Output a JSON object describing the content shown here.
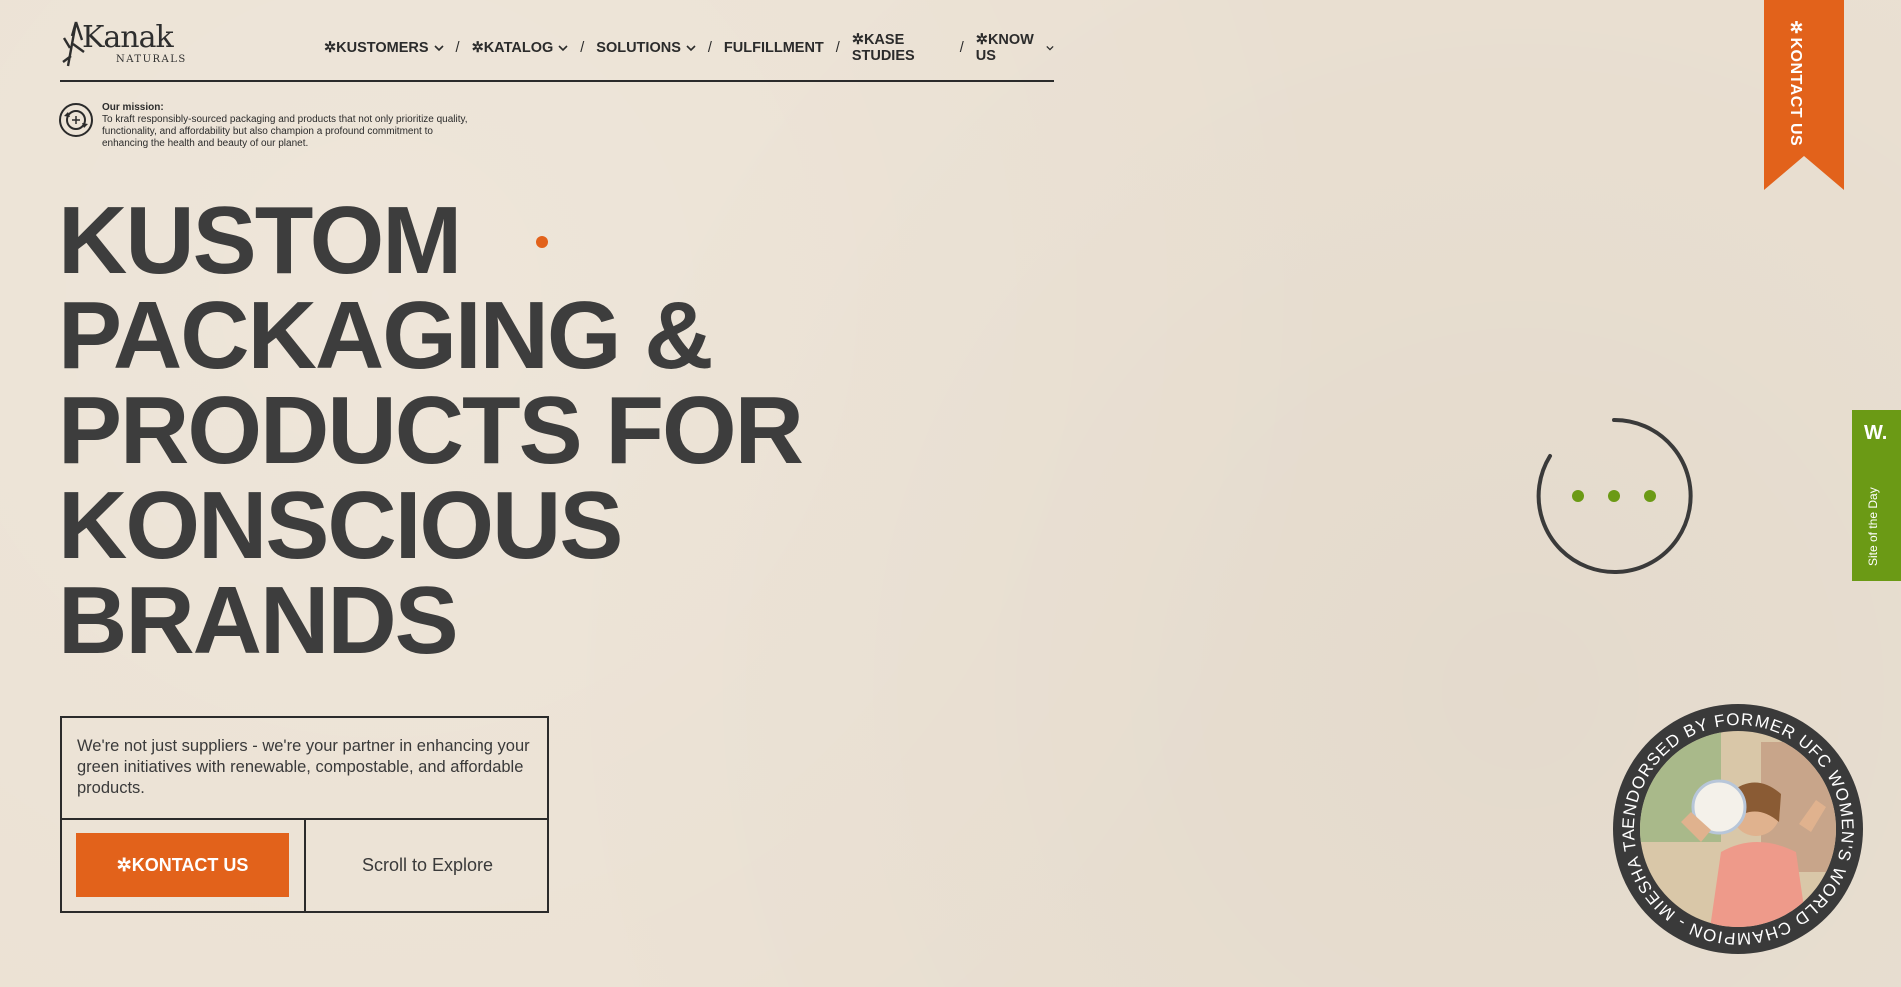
{
  "brand": {
    "name": "Kanak",
    "sub": "NATURALS"
  },
  "nav": {
    "items": [
      {
        "label": "✲KUSTOMERS",
        "dropdown": true
      },
      {
        "label": "✲KATALOG",
        "dropdown": true
      },
      {
        "label": "SOLUTIONS",
        "dropdown": true
      },
      {
        "label": "FULFILLMENT",
        "dropdown": false
      },
      {
        "label": "✲KASE STUDIES",
        "dropdown": false
      },
      {
        "label": "✲KNOW US",
        "dropdown": true
      }
    ],
    "separator": "/"
  },
  "mission": {
    "title": "Our mission:",
    "body": "To kraft responsibly-sourced packaging and products that not only prioritize quality, functionality, and affordability but also champion a profound commitment to enhancing the health and beauty of our planet."
  },
  "hero": {
    "lines": [
      "KUSTOM",
      "PACKAGING &",
      "PRODUCTS FOR",
      "KONSCIOUS",
      "BRANDS"
    ]
  },
  "cta": {
    "text": "We're not just suppliers - we're your partner in enhancing your green initiatives with renewable, compostable, and affordable products.",
    "button_label": "✲KONTACT US",
    "scroll_label": "Scroll to Explore"
  },
  "ribbon": {
    "label": "✲KONTACT US",
    "color": "#e2621b"
  },
  "site_of_day": {
    "mark": "W.",
    "label": "Site of the Day",
    "color": "#6b9a15"
  },
  "badge": {
    "ring_text": "ENDORSED BY FORMER UFC WOMEN'S WORLD CHAMPION - MIESHA TATE -"
  },
  "colors": {
    "accent": "#e2621b",
    "background": "#ebe1d3",
    "text": "#3a3a3a",
    "green": "#6b9a15"
  }
}
